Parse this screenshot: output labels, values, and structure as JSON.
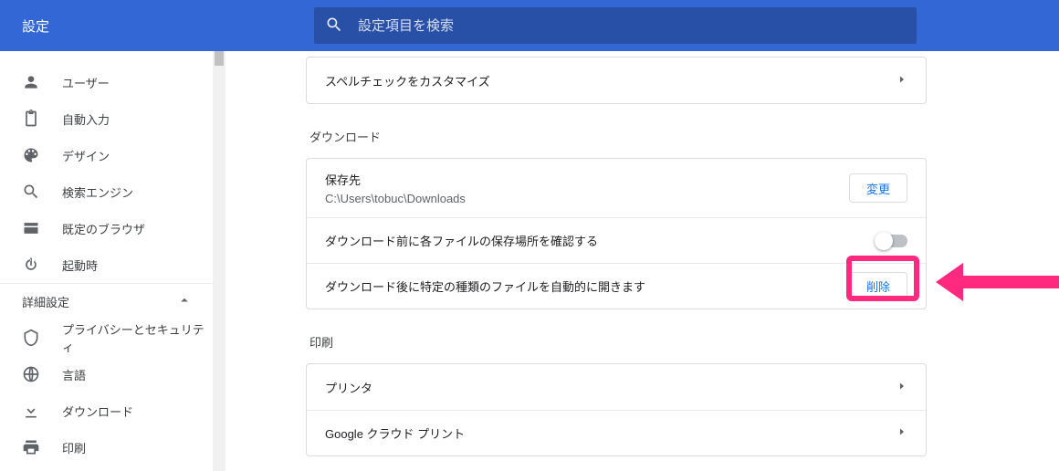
{
  "header": {
    "title": "設定",
    "search_placeholder": "設定項目を検索"
  },
  "sidebar": {
    "items": [
      {
        "label": "ユーザー"
      },
      {
        "label": "自動入力"
      },
      {
        "label": "デザイン"
      },
      {
        "label": "検索エンジン"
      },
      {
        "label": "既定のブラウザ"
      },
      {
        "label": "起動時"
      }
    ],
    "section_label": "詳細設定",
    "adv_items": [
      {
        "label": "プライバシーとセキュリティ"
      },
      {
        "label": "言語"
      },
      {
        "label": "ダウンロード"
      },
      {
        "label": "印刷"
      }
    ]
  },
  "main": {
    "spellcheck_row": "スペルチェックをカスタマイズ",
    "downloads": {
      "section_label": "ダウンロード",
      "location_label": "保存先",
      "location_value": "C:\\Users\\tobuc\\Downloads",
      "change_btn": "変更",
      "ask_where": "ダウンロード前に各ファイルの保存場所を確認する",
      "auto_open": "ダウンロード後に特定の種類のファイルを自動的に開きます",
      "clear_btn": "削除"
    },
    "printing": {
      "section_label": "印刷",
      "printers": "プリンタ",
      "cloud_print": "Google クラウド プリント"
    }
  }
}
